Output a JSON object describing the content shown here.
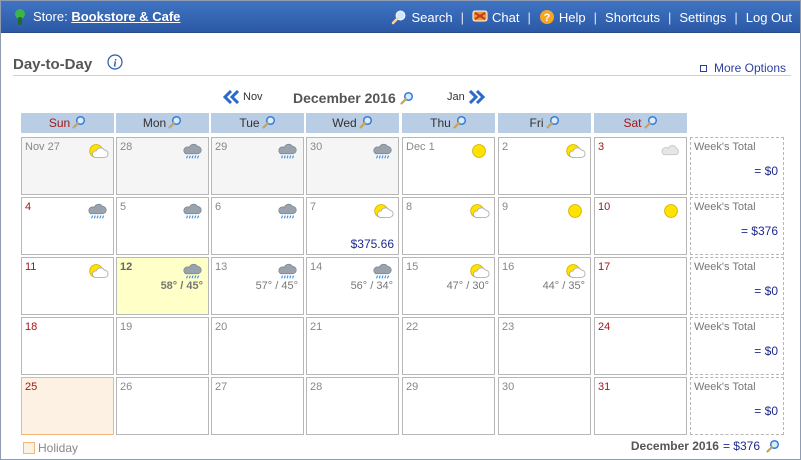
{
  "header": {
    "store_prefix": "Store:",
    "store_name": "Bookstore & Cafe",
    "nav": [
      {
        "label": "Search",
        "icon": "search-icon"
      },
      {
        "label": "Chat",
        "icon": "chat-icon"
      },
      {
        "label": "Help",
        "icon": "help-icon"
      },
      {
        "label": "Shortcuts"
      },
      {
        "label": "Settings"
      },
      {
        "label": "Log Out"
      }
    ]
  },
  "page": {
    "title": "Day-to-Day",
    "more_options": "More Options"
  },
  "month_nav": {
    "prev": "Nov",
    "current": "December 2016",
    "next": "Jan"
  },
  "weekdays": [
    "Sun",
    "Mon",
    "Tue",
    "Wed",
    "Thu",
    "Fri",
    "Sat"
  ],
  "week_total_label": "Week's Total",
  "weeks": [
    {
      "total": "= $0",
      "days": [
        {
          "date": "Nov 27",
          "weather": "partly-cloudy",
          "other": true
        },
        {
          "date": "28",
          "weather": "rain",
          "other": true
        },
        {
          "date": "29",
          "weather": "rain",
          "other": true
        },
        {
          "date": "30",
          "weather": "rain",
          "other": true
        },
        {
          "date": "Dec 1",
          "weather": "sunny"
        },
        {
          "date": "2",
          "weather": "partly-cloudy"
        },
        {
          "date": "3",
          "weather": "cloudy"
        }
      ]
    },
    {
      "total": "= $376",
      "days": [
        {
          "date": "4",
          "weather": "rain"
        },
        {
          "date": "5",
          "weather": "rain"
        },
        {
          "date": "6",
          "weather": "rain"
        },
        {
          "date": "7",
          "weather": "partly-cloudy",
          "amount": "$375.66"
        },
        {
          "date": "8",
          "weather": "partly-cloudy"
        },
        {
          "date": "9",
          "weather": "sunny"
        },
        {
          "date": "10",
          "weather": "sunny"
        }
      ]
    },
    {
      "total": "= $0",
      "days": [
        {
          "date": "11",
          "weather": "partly-cloudy"
        },
        {
          "date": "12",
          "weather": "rain",
          "temp": "58° / 45°",
          "today": true
        },
        {
          "date": "13",
          "weather": "rain",
          "temp": "57° / 45°"
        },
        {
          "date": "14",
          "weather": "rain",
          "temp": "56° / 34°"
        },
        {
          "date": "15",
          "weather": "partly-cloudy",
          "temp": "47° / 30°"
        },
        {
          "date": "16",
          "weather": "partly-cloudy",
          "temp": "44° / 35°"
        },
        {
          "date": "17"
        }
      ]
    },
    {
      "total": "= $0",
      "days": [
        {
          "date": "18"
        },
        {
          "date": "19"
        },
        {
          "date": "20"
        },
        {
          "date": "21"
        },
        {
          "date": "22"
        },
        {
          "date": "23"
        },
        {
          "date": "24"
        }
      ]
    },
    {
      "total": "= $0",
      "days": [
        {
          "date": "25",
          "holiday": true
        },
        {
          "date": "26"
        },
        {
          "date": "27"
        },
        {
          "date": "28"
        },
        {
          "date": "29"
        },
        {
          "date": "30"
        },
        {
          "date": "31"
        }
      ]
    }
  ],
  "footer": {
    "legend_holiday": "Holiday",
    "month_total_label": "December 2016",
    "month_total_value": "= $376"
  },
  "colors": {
    "header_bg": "#3f74c2",
    "day_header_bg": "#b9cde5",
    "weekend_text": "#a01818",
    "amount_text": "#1e2a8c",
    "today_bg": "#ffffc8",
    "holiday_bg": "#fdf1e4"
  }
}
